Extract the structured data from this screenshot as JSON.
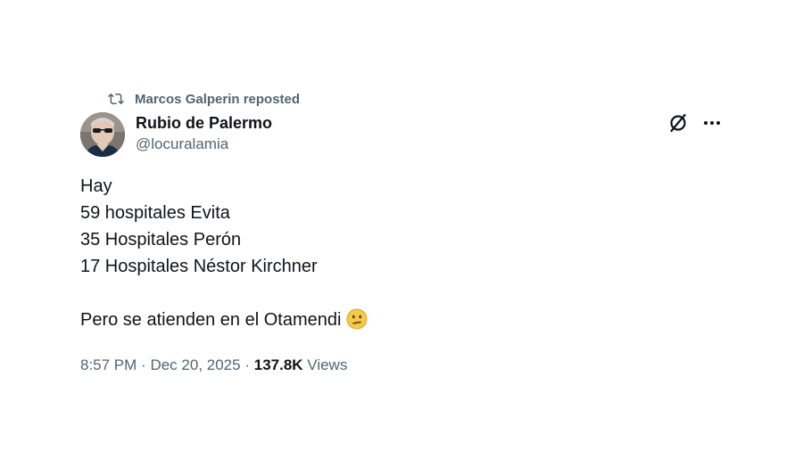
{
  "repost": {
    "text": "Marcos Galperin reposted",
    "icon": "repost-icon"
  },
  "author": {
    "display_name": "Rubio de Palermo",
    "handle": "@locuralamia",
    "avatar_icon": "avatar"
  },
  "actions": {
    "grok_icon": "grok-icon",
    "more_icon": "more-icon"
  },
  "tweet": {
    "lines": [
      "Hay",
      "59 hospitales Evita",
      "35 Hospitales Perón",
      "17 Hospitales Néstor Kirchner",
      "",
      "Pero se atienden en el Otamendi"
    ],
    "emoji": "confused-face-emoji"
  },
  "meta": {
    "time": "8:57 PM",
    "separator": "·",
    "date": "Dec 20, 2025",
    "views_count": "137.8K",
    "views_label": "Views"
  },
  "colors": {
    "text": "#0f1419",
    "secondary": "#536471",
    "background": "#ffffff"
  }
}
